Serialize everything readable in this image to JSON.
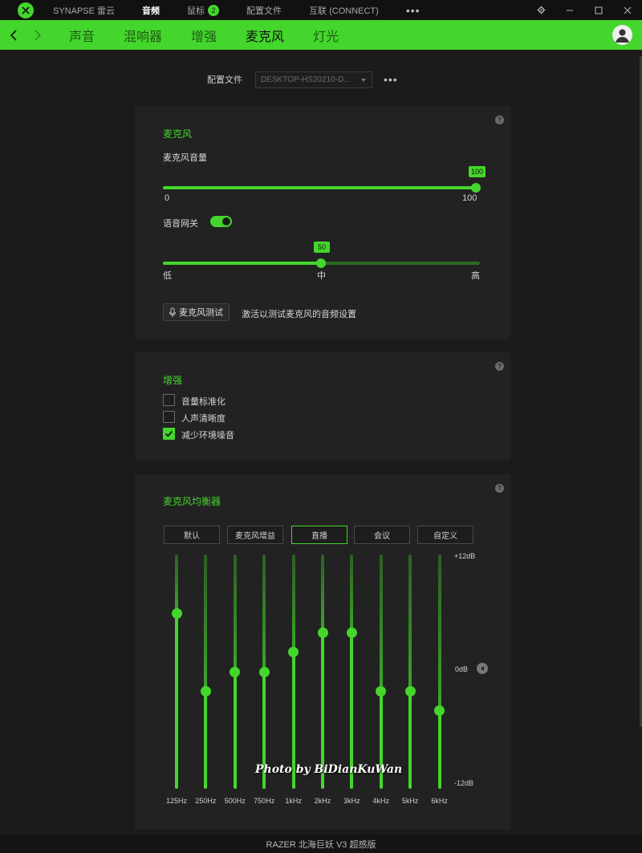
{
  "titlebar": {
    "items": [
      {
        "label": "SYNAPSE 雷云",
        "active": false
      },
      {
        "label": "音频",
        "active": true
      },
      {
        "label": "鼠标",
        "active": false,
        "badge": "2"
      },
      {
        "label": "配置文件",
        "active": false
      },
      {
        "label": "互联 (CONNECT)",
        "active": false
      }
    ],
    "more": "•••"
  },
  "tabs": [
    {
      "label": "声音",
      "active": false
    },
    {
      "label": "混响器",
      "active": false
    },
    {
      "label": "增强",
      "active": false
    },
    {
      "label": "麦克风",
      "active": true
    },
    {
      "label": "灯光",
      "active": false
    }
  ],
  "profile": {
    "label": "配置文件",
    "value": "DESKTOP-HS20210-D...",
    "more": "•••"
  },
  "mic_card": {
    "title": "麦克风",
    "volume_label": "麦克风音量",
    "volume_value": 100,
    "volume_tip": "100",
    "volume_min": "0",
    "volume_max": "100",
    "gate_label": "语音网关",
    "gate_on": true,
    "gate_value": 50,
    "gate_tip": "50",
    "gate_low": "低",
    "gate_mid": "中",
    "gate_high": "高",
    "test_button": "麦克风测试",
    "test_hint": "激活以测试麦克风的音频设置"
  },
  "enhance_card": {
    "title": "增强",
    "options": [
      {
        "label": "音量标准化",
        "checked": false
      },
      {
        "label": "人声清晰度",
        "checked": false
      },
      {
        "label": "减少环境噪音",
        "checked": true
      }
    ]
  },
  "eq_card": {
    "title": "麦克风均衡器",
    "presets": [
      {
        "label": "默认",
        "active": false
      },
      {
        "label": "麦克风增益",
        "active": false
      },
      {
        "label": "直播",
        "active": true
      },
      {
        "label": "会议",
        "active": false
      },
      {
        "label": "自定义",
        "active": false
      }
    ],
    "db_max": "+12dB",
    "db_mid": "0dB",
    "db_min": "-12dB",
    "bands": [
      {
        "freq": "125Hz",
        "gain": 6
      },
      {
        "freq": "250Hz",
        "gain": -2
      },
      {
        "freq": "500Hz",
        "gain": 0
      },
      {
        "freq": "750Hz",
        "gain": 0
      },
      {
        "freq": "1kHz",
        "gain": 2
      },
      {
        "freq": "2kHz",
        "gain": 4
      },
      {
        "freq": "3kHz",
        "gain": 4
      },
      {
        "freq": "4kHz",
        "gain": -2
      },
      {
        "freq": "5kHz",
        "gain": -2
      },
      {
        "freq": "6kHz",
        "gain": -4
      }
    ]
  },
  "watermark": "Photo by BiDianKuWan",
  "status_bar": "RAZER 北海巨妖 V3 超感版",
  "colors": {
    "accent": "#44d62c",
    "background": "#1b1b1b",
    "card": "#222222"
  }
}
